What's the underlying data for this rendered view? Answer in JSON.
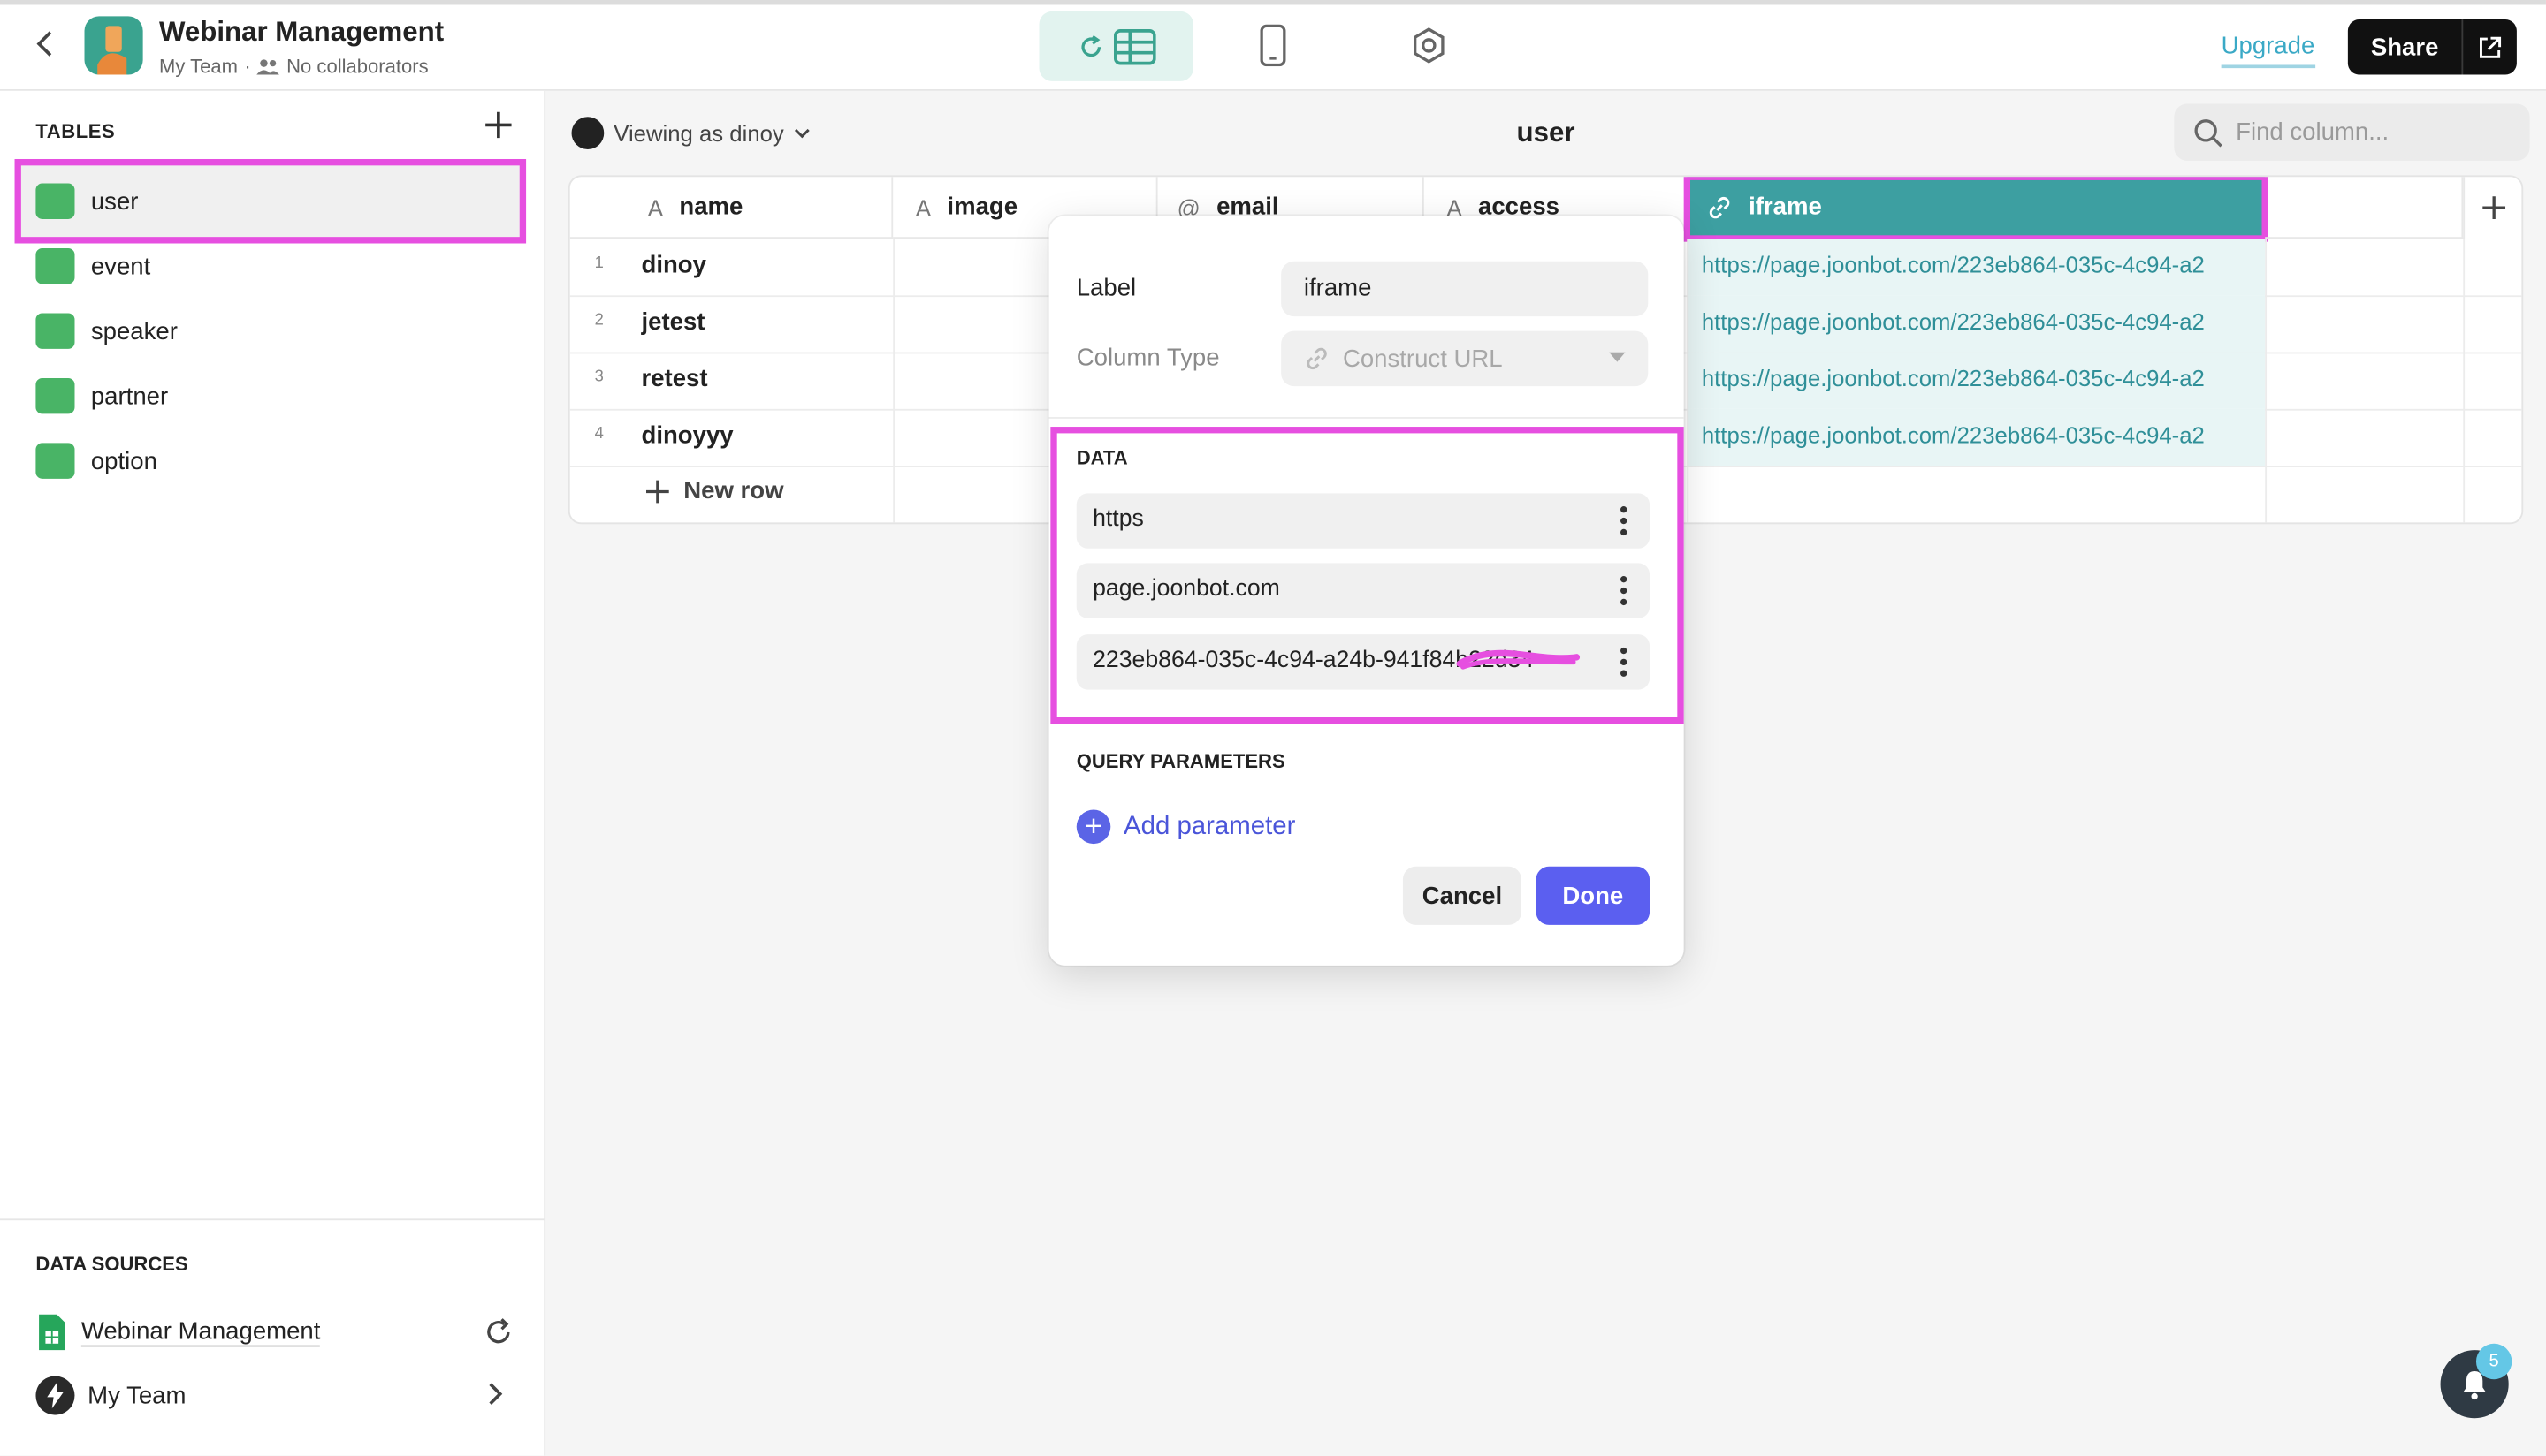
{
  "app": {
    "title": "Webinar Management",
    "team": "My Team",
    "collaborators": "No collaborators"
  },
  "header": {
    "upgrade": "Upgrade",
    "share": "Share"
  },
  "sidebar": {
    "tables_heading": "TABLES",
    "tables": [
      {
        "label": "user"
      },
      {
        "label": "event"
      },
      {
        "label": "speaker"
      },
      {
        "label": "partner"
      },
      {
        "label": "option"
      }
    ],
    "data_sources_heading": "DATA SOURCES",
    "data_sources": [
      {
        "label": "Webinar Management"
      },
      {
        "label": "My Team"
      }
    ]
  },
  "main": {
    "viewing_as": "Viewing as dinoy",
    "table_title": "user",
    "find_placeholder": "Find column...",
    "columns": [
      {
        "type_icon": "A",
        "label": "name"
      },
      {
        "type_icon": "A",
        "label": "image"
      },
      {
        "type_icon": "@",
        "label": "email"
      },
      {
        "type_icon": "A",
        "label": "access"
      },
      {
        "type_icon": "link-icon",
        "label": "iframe"
      }
    ],
    "rows": [
      {
        "num": "1",
        "name": "dinoy",
        "iframe": "https://page.joonbot.com/223eb864-035c-4c94-a2"
      },
      {
        "num": "2",
        "name": "jetest",
        "iframe": "https://page.joonbot.com/223eb864-035c-4c94-a2"
      },
      {
        "num": "3",
        "name": "retest",
        "iframe": "https://page.joonbot.com/223eb864-035c-4c94-a2"
      },
      {
        "num": "4",
        "name": "dinoyyy",
        "iframe": "https://page.joonbot.com/223eb864-035c-4c94-a2"
      }
    ],
    "new_row": "New row"
  },
  "popover": {
    "label_label": "Label",
    "label_value": "iframe",
    "column_type_label": "Column Type",
    "column_type_value": "Construct URL",
    "data_heading": "DATA",
    "data_items": [
      "https",
      "page.joonbot.com",
      "223eb864-035c-4c94-a24b-941f84b22d34"
    ],
    "query_heading": "QUERY PARAMETERS",
    "add_parameter": "Add parameter",
    "cancel": "Cancel",
    "done": "Done"
  },
  "notifications": {
    "count": "5"
  },
  "colors": {
    "accent": "#3d9fa1",
    "highlight": "#e64fe0",
    "primary_button": "#5b5ff0"
  }
}
